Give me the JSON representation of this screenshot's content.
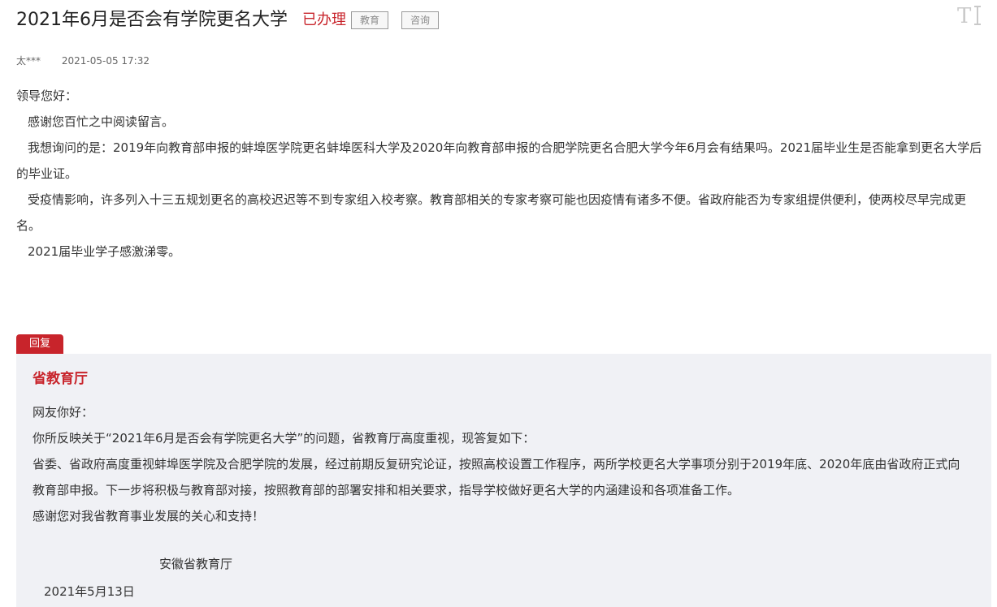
{
  "header": {
    "title": "2021年6月是否会有学院更名大学",
    "status": "已办理",
    "tags": [
      "教育",
      "咨询"
    ],
    "font_size_toggle_icon": "font-size-icon"
  },
  "meta": {
    "author": "太***",
    "date": "2021-05-05 17:32"
  },
  "question": {
    "greeting": "领导您好：",
    "paragraphs": [
      "感谢您百忙之中阅读留言。",
      "我想询问的是：2019年向教育部申报的蚌埠医学院更名蚌埠医科大学及2020年向教育部申报的合肥学院更名合肥大学今年6月会有结果吗。2021届毕业生是否能拿到更名大学后的毕业证。",
      "受疫情影响，许多列入十三五规划更名的高校迟迟等不到专家组入校考察。教育部相关的专家考察可能也因疫情有诸多不便。省政府能否为专家组提供便利，使两校尽早完成更名。",
      "2021届毕业学子感激涕零。"
    ]
  },
  "reply": {
    "tab_label": "回复",
    "department": "省教育厅",
    "lines": [
      "网友你好：",
      "你所反映关于“2021年6月是否会有学院更名大学”的问题，省教育厅高度重视，现答复如下：",
      "省委、省政府高度重视蚌埠医学院及合肥学院的发展，经过前期反复研究论证，按照高校设置工作程序，两所学校更名大学事项分别于2019年底、2020年底由省政府正式向教育部申报。下一步将积极与教育部对接，按照教育部的部署安排和相关要求，指导学校做好更名大学的内涵建设和各项准备工作。",
      "感谢您对我省教育事业发展的关心和支持！"
    ],
    "signature": "安徽省教育厅",
    "date": "2021年5月13日"
  },
  "colors": {
    "accent": "#c8242b",
    "reply_background": "#f0f1f5",
    "text": "#333333"
  }
}
